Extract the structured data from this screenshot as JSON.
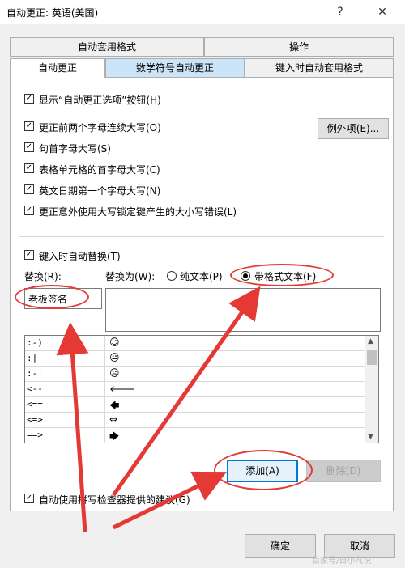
{
  "window": {
    "title": "自动更正: 英语(美国)",
    "help": "?",
    "close": "✕"
  },
  "tabs": {
    "top_left": "自动套用格式",
    "top_right": "操作",
    "autocorrect": "自动更正",
    "math": "数学符号自动更正",
    "autoformat_typing": "键入时自动套用格式"
  },
  "options": {
    "show_buttons": "显示“自动更正选项”按钮(H)",
    "two_initials": "更正前两个字母连续大写(O)",
    "sentence_cap": "句首字母大写(S)",
    "table_cell_cap": "表格单元格的首字母大写(C)",
    "day_names": "英文日期第一个字母大写(N)",
    "caps_lock": "更正意外使用大写锁定键产生的大小写错误(L)",
    "exceptions_button": "例外项(E)...",
    "replace_as_you_type": "键入时自动替换(T)"
  },
  "replace": {
    "replace_label": "替换(R):",
    "with_label": "替换为(W):",
    "plain_text": "纯文本(P)",
    "formatted_text": "带格式文本(F)",
    "replace_value": "老板签名",
    "with_value": ""
  },
  "entries": [
    {
      "from": ":-)",
      "to": "☺"
    },
    {
      "from": ":|",
      "to": "😐"
    },
    {
      "from": ":-|",
      "to": "☹"
    },
    {
      "from": "<--",
      "to": "🡐"
    },
    {
      "from": "<==",
      "to": "🡄"
    },
    {
      "from": "<=>",
      "to": "⇔"
    },
    {
      "from": "==>",
      "to": "🡆"
    }
  ],
  "buttons": {
    "add": "添加(A)",
    "delete": "删除(D)",
    "ok": "确定",
    "cancel": "取消"
  },
  "spellcheck": "自动使用拼写检查器提供的建议(G)",
  "watermark": "百家号/日小凡说",
  "colors": {
    "accent": "#0078d7",
    "annotation": "#e53935",
    "tab_highlight": "#cce4f7"
  }
}
